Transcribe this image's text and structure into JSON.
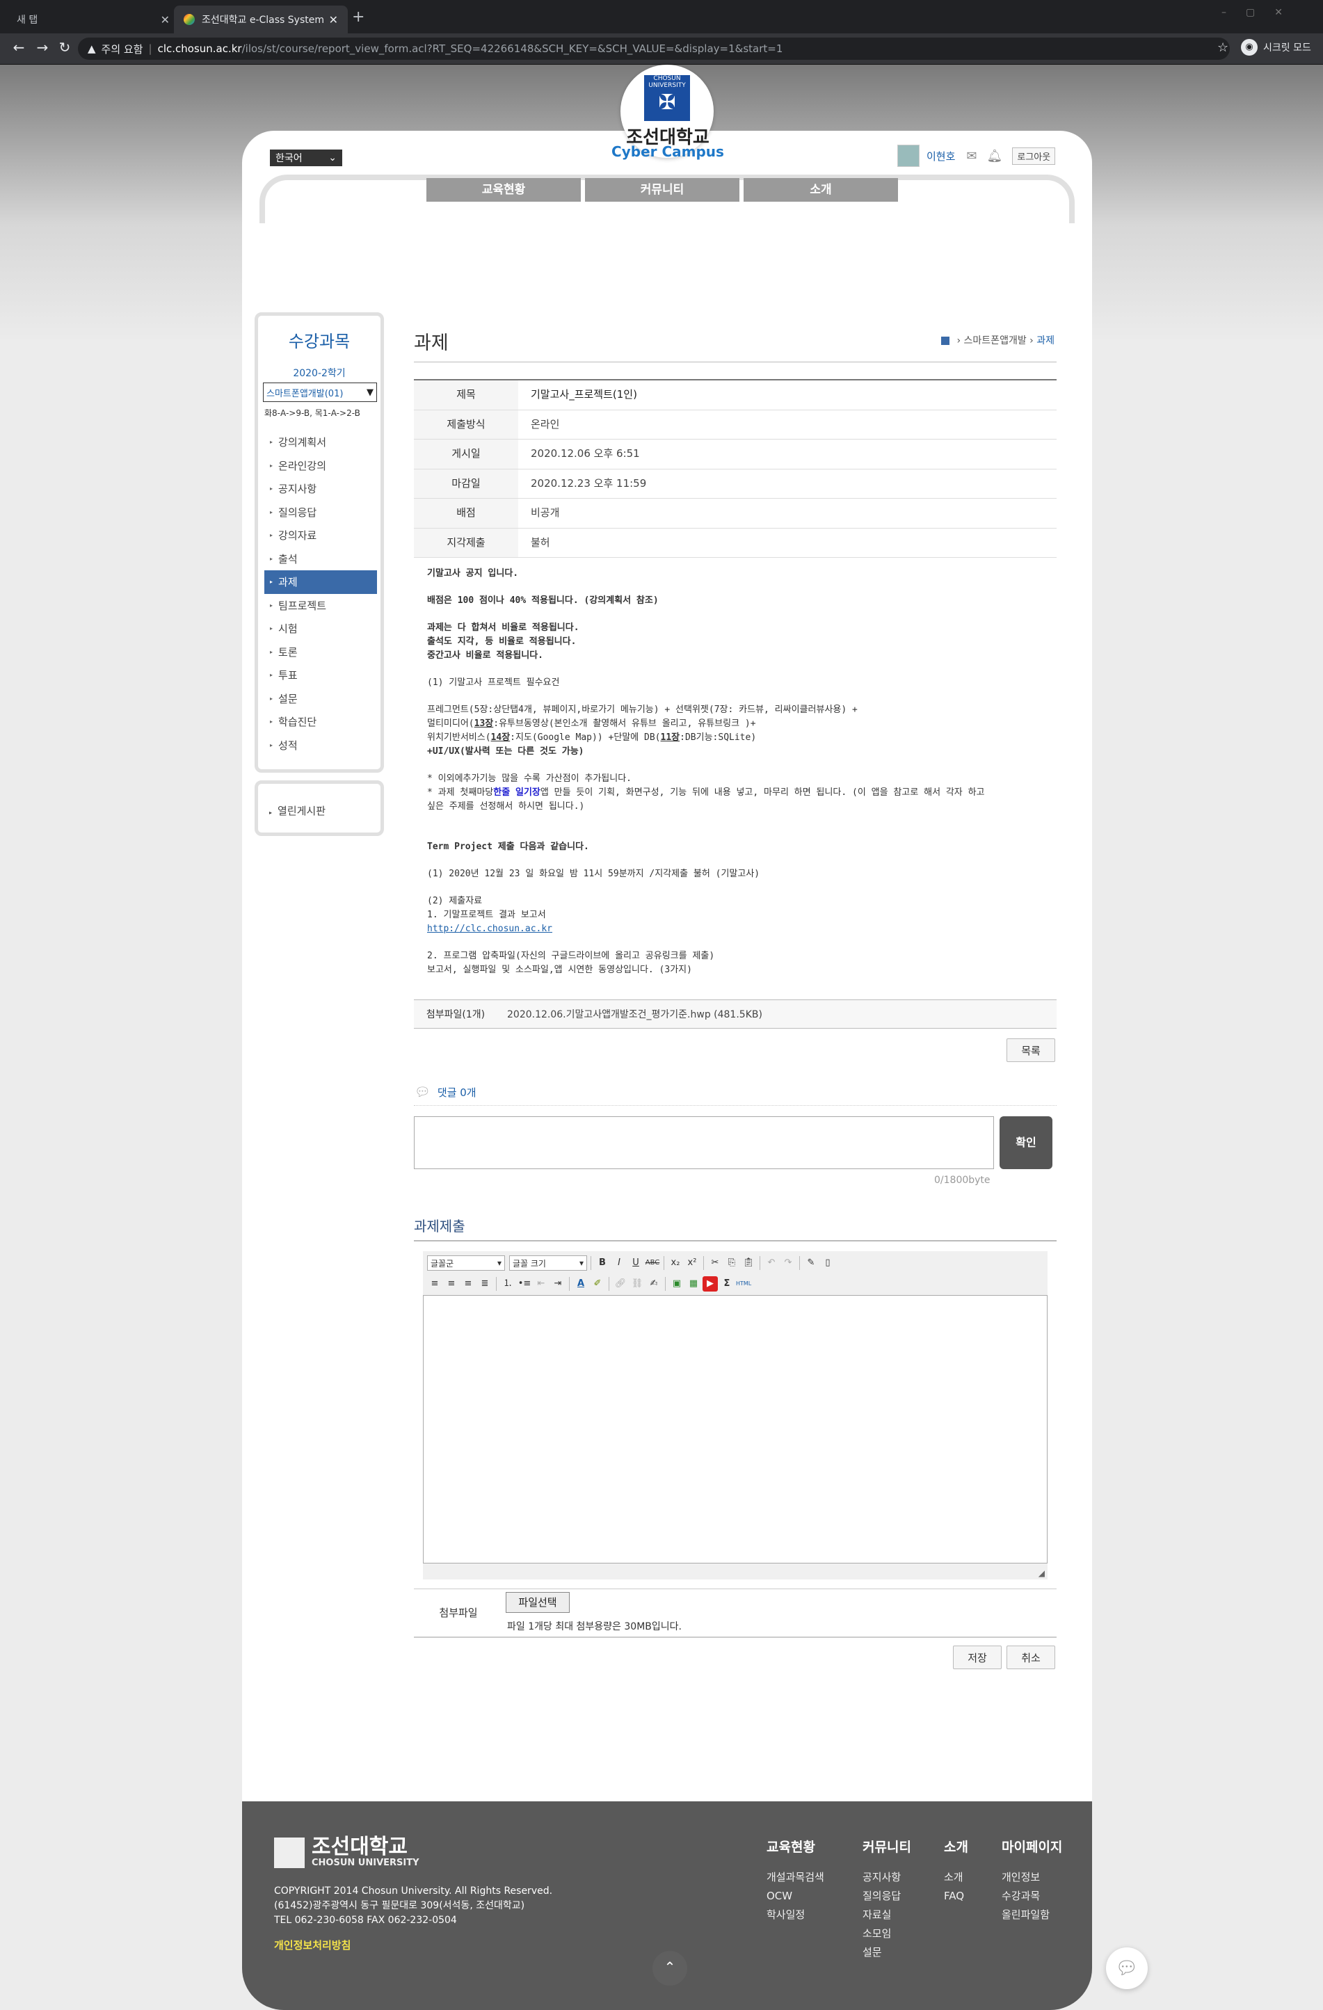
{
  "browser": {
    "tabs": [
      {
        "label": "새 탭"
      },
      {
        "label": "조선대학교 e-Class System"
      }
    ],
    "new_tab": "+",
    "address": {
      "warning": "주의 요함",
      "host": "clc.chosun.ac.kr",
      "path": "/ilos/st/course/report_view_form.acl?RT_SEQ=42266148&SCH_KEY=&SCH_VALUE=&display=1&start=1"
    },
    "incognito_label": "시크릿 모드"
  },
  "header": {
    "logo_text": "CHOSUN UNIVERSITY",
    "univ_name": "조선대학교",
    "cyber_campus": "Cyber Campus",
    "language": "한국어",
    "user_name": "이현호",
    "logout": "로그아웃"
  },
  "gnb": [
    {
      "label": "교육현황"
    },
    {
      "label": "커뮤니티"
    },
    {
      "label": "소개"
    }
  ],
  "sidebar": {
    "title": "수강과목",
    "term": "2020-2학기",
    "course": "스마트폰앱개발(01)",
    "schedule": "화8-A->9-B, 목1-A->2-B",
    "items": [
      {
        "label": "강의계획서"
      },
      {
        "label": "온라인강의"
      },
      {
        "label": "공지사항"
      },
      {
        "label": "질의응답"
      },
      {
        "label": "강의자료"
      },
      {
        "label": "출석"
      },
      {
        "label": "과제"
      },
      {
        "label": "팀프로젝트"
      },
      {
        "label": "시험"
      },
      {
        "label": "토론"
      },
      {
        "label": "투표"
      },
      {
        "label": "설문"
      },
      {
        "label": "학습진단"
      },
      {
        "label": "성적"
      }
    ],
    "active_index": 6,
    "extra": "열린게시판"
  },
  "content": {
    "title": "과제",
    "breadcrumb": {
      "course": "스마트폰앱개발",
      "current": "과제"
    },
    "info": [
      {
        "label": "제목",
        "value": "기말고사_프로젝트(1인)"
      },
      {
        "label": "제출방식",
        "value": "온라인"
      },
      {
        "label": "게시일",
        "value": "2020.12.06 오후 6:51"
      },
      {
        "label": "마감일",
        "value": "2020.12.23 오후 11:59"
      },
      {
        "label": "배점",
        "value": "비공개"
      },
      {
        "label": "지각제출",
        "value": "불허"
      }
    ],
    "body": {
      "l1": "기말고사 공지 입니다.",
      "l2": "배점은 100 점이나 40% 적용됩니다. (강의계획서 참조)",
      "l3": "과제는 다 합쳐서 비율로 적용됩니다.",
      "l4": "출석도 지각, 등 비율로 적용됩니다.",
      "l5": "중간고사 비율로 적용됩니다.",
      "l6": "(1) 기말고사 프로젝트 필수요건",
      "l7": "프레그먼트(5장:상단탭4개, 뷰페이지,바로가기 메뉴기능) + 선택위젯(7장: 카드뷰, 리싸이클러뷰사용) +",
      "l8a": "멀티미디어(",
      "l8b": "13장",
      "l8c": ":유투브동영상(본인소개 촬영해서 유튜브 올리고, 유튜브링크 )+",
      "l9a": "위치기반서비스(",
      "l9b": "14장",
      "l9c": ":지도(Google Map)) +단말에 DB(",
      "l9d": "11장",
      "l9e": ":DB기능:SQLite)",
      "l10": "+UI/UX(발사력 또는 다른 것도 가능)",
      "l11": "* 이외에추가기능 많을 수록 가산점이 추가됩니다.",
      "l12a": "* 과제 첫째마당",
      "l12b": "한줄 일기장",
      "l12c": "앱 만들 듯이 기획, 화면구성, 기능 뒤에 내용 넣고, 마무리 하면 됩니다. (이 앱을 참고로 해서 각자 하고",
      "l13": "싶은 주제를 선정해서 하시면 됩니다.)",
      "l14": "Term Project 제출 다음과 같습니다.",
      "l15": "(1) 2020년 12월 23 일 화요일 밤 11시 59분까지 /지각제출 불허 (기말고사)",
      "l16": "(2) 제출자료",
      "l17": "1. 기말프로젝트 결과 보고서",
      "l18": "http://clc.chosun.ac.kr",
      "l19": "2. 프로그램 압축파일(자신의 구글드라이브에 올리고 공유링크를 제출)",
      "l20": "보고서, 실행파일 및 소스파일,앱 시연한 동영상입니다. (3가지)"
    },
    "attachment": {
      "label": "첨부파일(1개)",
      "file": "2020.12.06.기말고사앱개발조건_평가기준.hwp (481.5KB)"
    },
    "list_button": "목록",
    "comments": {
      "label": "댓글 0개",
      "confirm": "확인",
      "counter": "0/1800byte"
    },
    "submit": {
      "title": "과제제출",
      "font_select": "글꼴군",
      "size_select": "글꼴 크기",
      "file_label": "첨부파일",
      "file_button": "파일선택",
      "file_hint": "파일 1개당 최대 첨부용량은 30MB입니다.",
      "save": "저장",
      "cancel": "취소"
    }
  },
  "footer": {
    "logo_name": "조선대학교",
    "logo_sub": "CHOSUN UNIVERSITY",
    "copyright": "COPYRIGHT 2014 Chosun University. All Rights Reserved.",
    "address": "(61452)광주광역시 동구 필문대로 309(서석동, 조선대학교)",
    "tel": "TEL 062-230-6058 FAX 062-232-0504",
    "privacy": "개인정보처리방침",
    "columns": [
      {
        "title": "교육현황",
        "items": [
          "개설과목검색",
          "OCW",
          "학사일정"
        ]
      },
      {
        "title": "커뮤니티",
        "items": [
          "공지사항",
          "질의응답",
          "자료실",
          "소모임",
          "설문"
        ]
      },
      {
        "title": "소개",
        "items": [
          "소개",
          "FAQ"
        ]
      },
      {
        "title": "마이페이지",
        "items": [
          "개인정보",
          "수강과목",
          "올린파일함"
        ]
      }
    ]
  },
  "colors": {
    "accent": "#1b5fa8",
    "active_menu": "#3a6aa8",
    "footer": "#595959",
    "privacy": "#f5e34a"
  }
}
